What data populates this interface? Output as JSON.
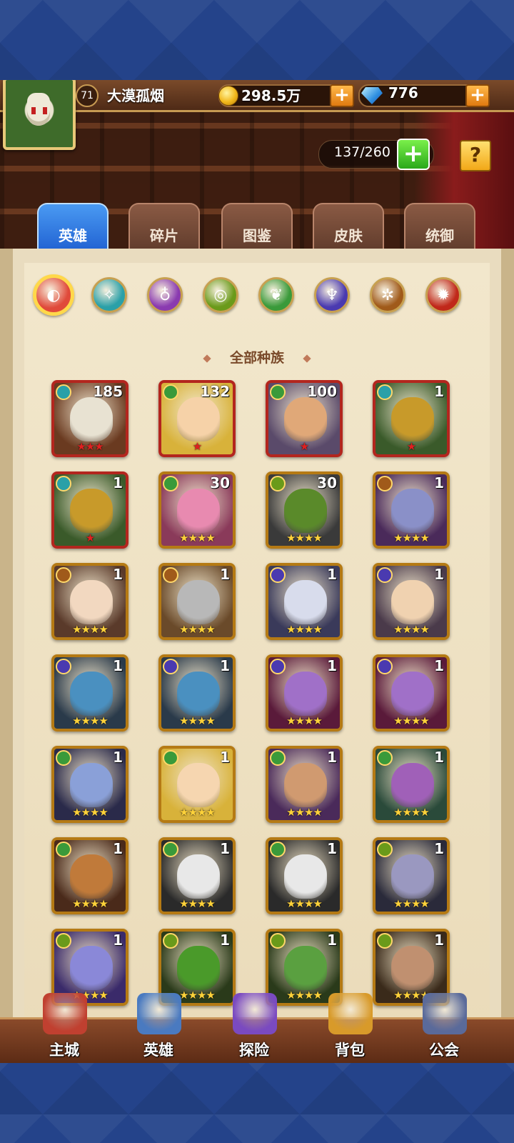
{
  "player": {
    "level": "71",
    "name": "大漠孤烟"
  },
  "resources": {
    "gold": "298.5万",
    "gems": "776",
    "gold_icon": "coin-icon",
    "gem_icon": "diamond-icon"
  },
  "capacity": {
    "text": "137/260"
  },
  "help_label": "?",
  "add_label": "+",
  "tabs": [
    {
      "label": "英雄",
      "active": true
    },
    {
      "label": "碎片"
    },
    {
      "label": "图鉴"
    },
    {
      "label": "皮肤"
    },
    {
      "label": "统御"
    }
  ],
  "races": [
    {
      "name": "all-races-icon",
      "color": "#e04a3a",
      "glyph": "◐",
      "selected": true
    },
    {
      "name": "shadow-race-icon",
      "color": "#2aa0a8",
      "glyph": "✧"
    },
    {
      "name": "fortress-race-icon",
      "color": "#8a3ab0",
      "glyph": "♁"
    },
    {
      "name": "abyss-race-icon",
      "color": "#6a9a1a",
      "glyph": "◎"
    },
    {
      "name": "forest-race-icon",
      "color": "#3a9a3a",
      "glyph": "❦"
    },
    {
      "name": "dark-race-icon",
      "color": "#4a3ab0",
      "glyph": "♆"
    },
    {
      "name": "light-race-icon",
      "color": "#a05a1a",
      "glyph": "✲"
    },
    {
      "name": "chaos-race-icon",
      "color": "#c0281a",
      "glyph": "✹"
    }
  ],
  "section_title": "全部种族",
  "heroes": [
    {
      "count": "185",
      "stars": "★★★",
      "star_color": "red",
      "rank": "red",
      "badge": "#2aa0a8",
      "face": "#e8e2d2",
      "bg": "#6a3a20"
    },
    {
      "count": "132",
      "stars": "★",
      "star_color": "red",
      "rank": "red",
      "badge": "#3a9a3a",
      "face": "#f6d2a8",
      "bg": "#d8b23a"
    },
    {
      "count": "100",
      "stars": "★",
      "star_color": "red",
      "rank": "red",
      "badge": "#3a9a3a",
      "face": "#e0a878",
      "bg": "#5a4a6a"
    },
    {
      "count": "1",
      "stars": "★",
      "star_color": "red",
      "rank": "red",
      "badge": "#2aa0a8",
      "face": "#c89a2a",
      "bg": "#3a5a2a"
    },
    {
      "count": "1",
      "stars": "★",
      "star_color": "red",
      "rank": "red",
      "badge": "#2aa0a8",
      "face": "#c89a2a",
      "bg": "#3a5a2a"
    },
    {
      "count": "30",
      "stars": "★★★★",
      "star_color": "gold",
      "rank": "gold",
      "badge": "#3a9a3a",
      "face": "#e88ab0",
      "bg": "#8a3a5a"
    },
    {
      "count": "30",
      "stars": "★★★★",
      "star_color": "gold",
      "rank": "gold",
      "badge": "#6a9a1a",
      "face": "#5a8a2a",
      "bg": "#3a3a3a"
    },
    {
      "count": "1",
      "stars": "★★★★",
      "star_color": "gold",
      "rank": "gold",
      "badge": "#a05a1a",
      "face": "#8a90c8",
      "bg": "#4a2a5a"
    },
    {
      "count": "1",
      "stars": "★★★★",
      "star_color": "gold",
      "rank": "gold",
      "badge": "#a05a1a",
      "face": "#f2d8c0",
      "bg": "#5a3a2a"
    },
    {
      "count": "1",
      "stars": "★★★★",
      "star_color": "gold",
      "rank": "gold",
      "badge": "#a05a1a",
      "face": "#b8b8b8",
      "bg": "#6a4a2a"
    },
    {
      "count": "1",
      "stars": "★★★★",
      "star_color": "gold",
      "rank": "gold",
      "badge": "#4a3ab0",
      "face": "#d8dcec",
      "bg": "#3a3a5a"
    },
    {
      "count": "1",
      "stars": "★★★★",
      "star_color": "gold",
      "rank": "gold",
      "badge": "#4a3ab0",
      "face": "#f0d2b0",
      "bg": "#4a3a4a"
    },
    {
      "count": "1",
      "stars": "★★★★",
      "star_color": "gold",
      "rank": "gold",
      "badge": "#4a3ab0",
      "face": "#4a90c0",
      "bg": "#2a3a4a"
    },
    {
      "count": "1",
      "stars": "★★★★",
      "star_color": "gold",
      "rank": "gold",
      "badge": "#4a3ab0",
      "face": "#4a90c0",
      "bg": "#2a3a4a"
    },
    {
      "count": "1",
      "stars": "★★★★",
      "star_color": "gold",
      "rank": "gold",
      "badge": "#4a3ab0",
      "face": "#a070c8",
      "bg": "#5a1a3a"
    },
    {
      "count": "1",
      "stars": "★★★★",
      "star_color": "gold",
      "rank": "gold",
      "badge": "#4a3ab0",
      "face": "#a070c8",
      "bg": "#5a1a3a"
    },
    {
      "count": "1",
      "stars": "★★★★",
      "star_color": "gold",
      "rank": "gold",
      "badge": "#3a9a3a",
      "face": "#8aa0d8",
      "bg": "#2a2a4a"
    },
    {
      "count": "1",
      "stars": "★★★★",
      "star_color": "gold",
      "rank": "gold",
      "badge": "#3a9a3a",
      "face": "#f6d6b0",
      "bg": "#d8b23a"
    },
    {
      "count": "1",
      "stars": "★★★★",
      "star_color": "gold",
      "rank": "gold",
      "badge": "#3a9a3a",
      "face": "#d09a70",
      "bg": "#4a2a5a"
    },
    {
      "count": "1",
      "stars": "★★★★",
      "star_color": "gold",
      "rank": "gold",
      "badge": "#3a9a3a",
      "face": "#a060b8",
      "bg": "#2a4a3a"
    },
    {
      "count": "1",
      "stars": "★★★★",
      "star_color": "gold",
      "rank": "gold",
      "badge": "#3a9a3a",
      "face": "#c07a3a",
      "bg": "#4a2a1a"
    },
    {
      "count": "1",
      "stars": "★★★★",
      "star_color": "gold",
      "rank": "gold",
      "badge": "#3a9a3a",
      "face": "#e8e8e8",
      "bg": "#2a2a2a"
    },
    {
      "count": "1",
      "stars": "★★★★",
      "star_color": "gold",
      "rank": "gold",
      "badge": "#3a9a3a",
      "face": "#e8e8e8",
      "bg": "#2a2a2a"
    },
    {
      "count": "1",
      "stars": "★★★★",
      "star_color": "gold",
      "rank": "gold",
      "badge": "#6a9a1a",
      "face": "#9a98c0",
      "bg": "#2a2a3a"
    },
    {
      "count": "1",
      "stars": "★★★★",
      "star_color": "gold",
      "rank": "gold",
      "badge": "#6a9a1a",
      "face": "#8a88d8",
      "bg": "#3a2a6a"
    },
    {
      "count": "1",
      "stars": "★★★★",
      "star_color": "gold",
      "rank": "gold",
      "badge": "#6a9a1a",
      "face": "#4a9a2a",
      "bg": "#2a3a1a"
    },
    {
      "count": "1",
      "stars": "★★★★",
      "star_color": "gold",
      "rank": "gold",
      "badge": "#6a9a1a",
      "face": "#5aa040",
      "bg": "#2a3a1a"
    },
    {
      "count": "1",
      "stars": "★★★★",
      "star_color": "gold",
      "rank": "gold",
      "badge": "#6a9a1a",
      "face": "#c09070",
      "bg": "#3a2a1a"
    }
  ],
  "nav": [
    {
      "label": "主城",
      "icon": "castle-icon",
      "color": "#c04030"
    },
    {
      "label": "英雄",
      "icon": "hero-portrait-icon",
      "color": "#4a7ac0"
    },
    {
      "label": "探险",
      "icon": "portal-icon",
      "color": "#7a4ac0"
    },
    {
      "label": "背包",
      "icon": "backpack-icon",
      "color": "#d89a2a"
    },
    {
      "label": "公会",
      "icon": "guild-tower-icon",
      "color": "#5a6a9a"
    }
  ]
}
